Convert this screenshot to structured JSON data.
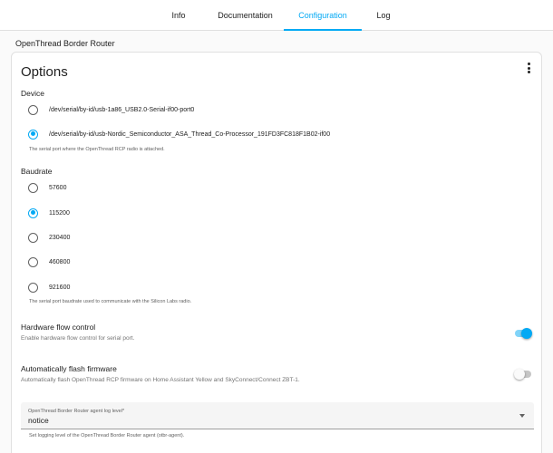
{
  "tabs": [
    {
      "label": "Info",
      "active": false
    },
    {
      "label": "Documentation",
      "active": false
    },
    {
      "label": "Configuration",
      "active": true
    },
    {
      "label": "Log",
      "active": false
    }
  ],
  "section_title": "OpenThread Border Router",
  "card": {
    "title": "Options",
    "menu_icon": "dots-vertical-icon"
  },
  "device": {
    "label": "Device",
    "options": [
      {
        "label": "/dev/serial/by-id/usb-1a86_USB2.0-Serial-if00-port0",
        "checked": false
      },
      {
        "label": "/dev/serial/by-id/usb-Nordic_Semiconductor_ASA_Thread_Co-Processor_191FD3FC818F1B02-if00",
        "checked": true
      }
    ],
    "helper": "The serial port where the OpenThread RCP radio is attached."
  },
  "baudrate": {
    "label": "Baudrate",
    "options": [
      {
        "label": "57600",
        "checked": false
      },
      {
        "label": "115200",
        "checked": true
      },
      {
        "label": "230400",
        "checked": false
      },
      {
        "label": "460800",
        "checked": false
      },
      {
        "label": "921600",
        "checked": false
      }
    ],
    "helper": "The serial port baudrate used to communicate with the Silicon Labs radio."
  },
  "hardware_flow_control": {
    "title": "Hardware flow control",
    "description": "Enable hardware flow control for serial port.",
    "enabled": true
  },
  "auto_flash_firmware": {
    "title": "Automatically flash firmware",
    "description": "Automatically flash OpenThread RCP firmware on Home Assistant Yellow and SkyConnect/Connect ZBT-1.",
    "enabled": false
  },
  "log_level": {
    "label": "OpenThread Border Router agent log level*",
    "value": "notice",
    "helper": "Set logging level of the OpenThread Border Router agent (otbr-agent)."
  },
  "colors": {
    "accent": "#03a9f4",
    "text": "#212121",
    "secondary_text": "#757575"
  }
}
